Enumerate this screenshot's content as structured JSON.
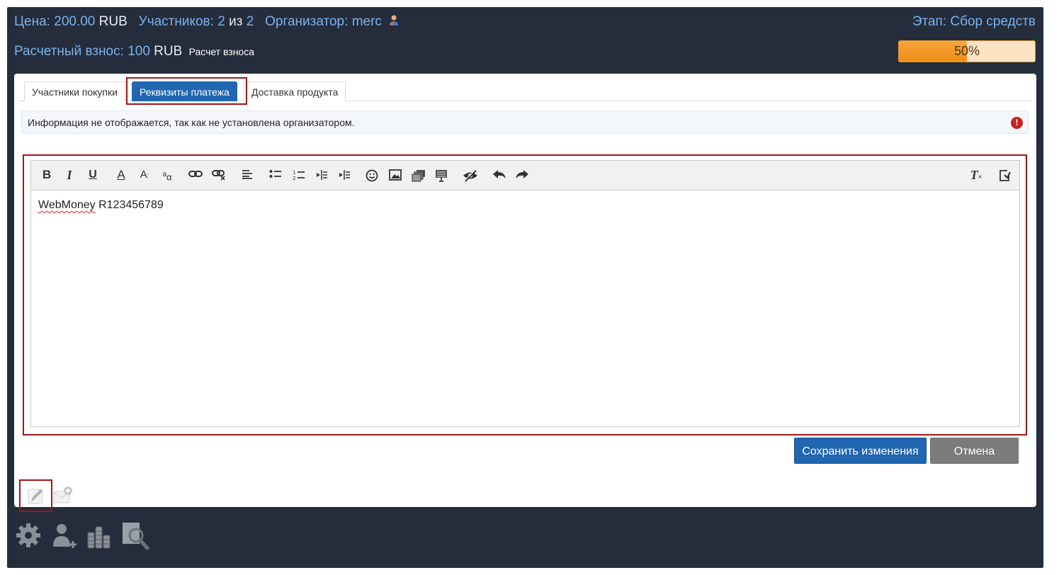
{
  "header": {
    "price_label": "Цена:",
    "price_value": "200.00",
    "price_currency": "RUB",
    "participants_label": "Участников:",
    "participants_current": "2",
    "participants_of": "из",
    "participants_total": "2",
    "organizer_label": "Организатор:",
    "organizer_name": "merc",
    "stage_label": "Этап:",
    "stage_value": "Сбор средств",
    "fee_label": "Расчетный взнос:",
    "fee_value": "100",
    "fee_currency": "RUB",
    "fee_calc_link": "Расчет взноса",
    "progress_text": "50%",
    "progress_value": 0.5
  },
  "tabs": [
    {
      "label": "Участники покупки",
      "active": false
    },
    {
      "label": "Реквизиты платежа",
      "active": true
    },
    {
      "label": "Доставка продукта",
      "active": false
    }
  ],
  "info_message": "Информация не отображается, так как не установлена организатором.",
  "editor": {
    "toolbar": [
      "bold-icon",
      "italic-icon",
      "underline-icon",
      "font-color-icon",
      "font-size-icon",
      "text-case-icon",
      "link-icon",
      "unlink-icon",
      "align-left-icon",
      "bullet-list-icon",
      "numbered-list-icon",
      "outdent-icon",
      "indent-icon",
      "smiley-icon",
      "image-icon",
      "media-icon",
      "template-icon",
      "hide-icon",
      "undo-icon",
      "redo-icon",
      "remove-format-icon",
      "toggle-bbcode-icon"
    ],
    "content_word1": "WebMoney",
    "content_word2": "R123456789"
  },
  "buttons": {
    "save": "Сохранить изменения",
    "cancel": "Отмена"
  },
  "colors": {
    "panel_bg": "#252c3b",
    "link_blue": "#7ab3ee",
    "primary": "#2166b0",
    "highlight_red": "#a31515",
    "progress_orange": "#f18f16"
  }
}
